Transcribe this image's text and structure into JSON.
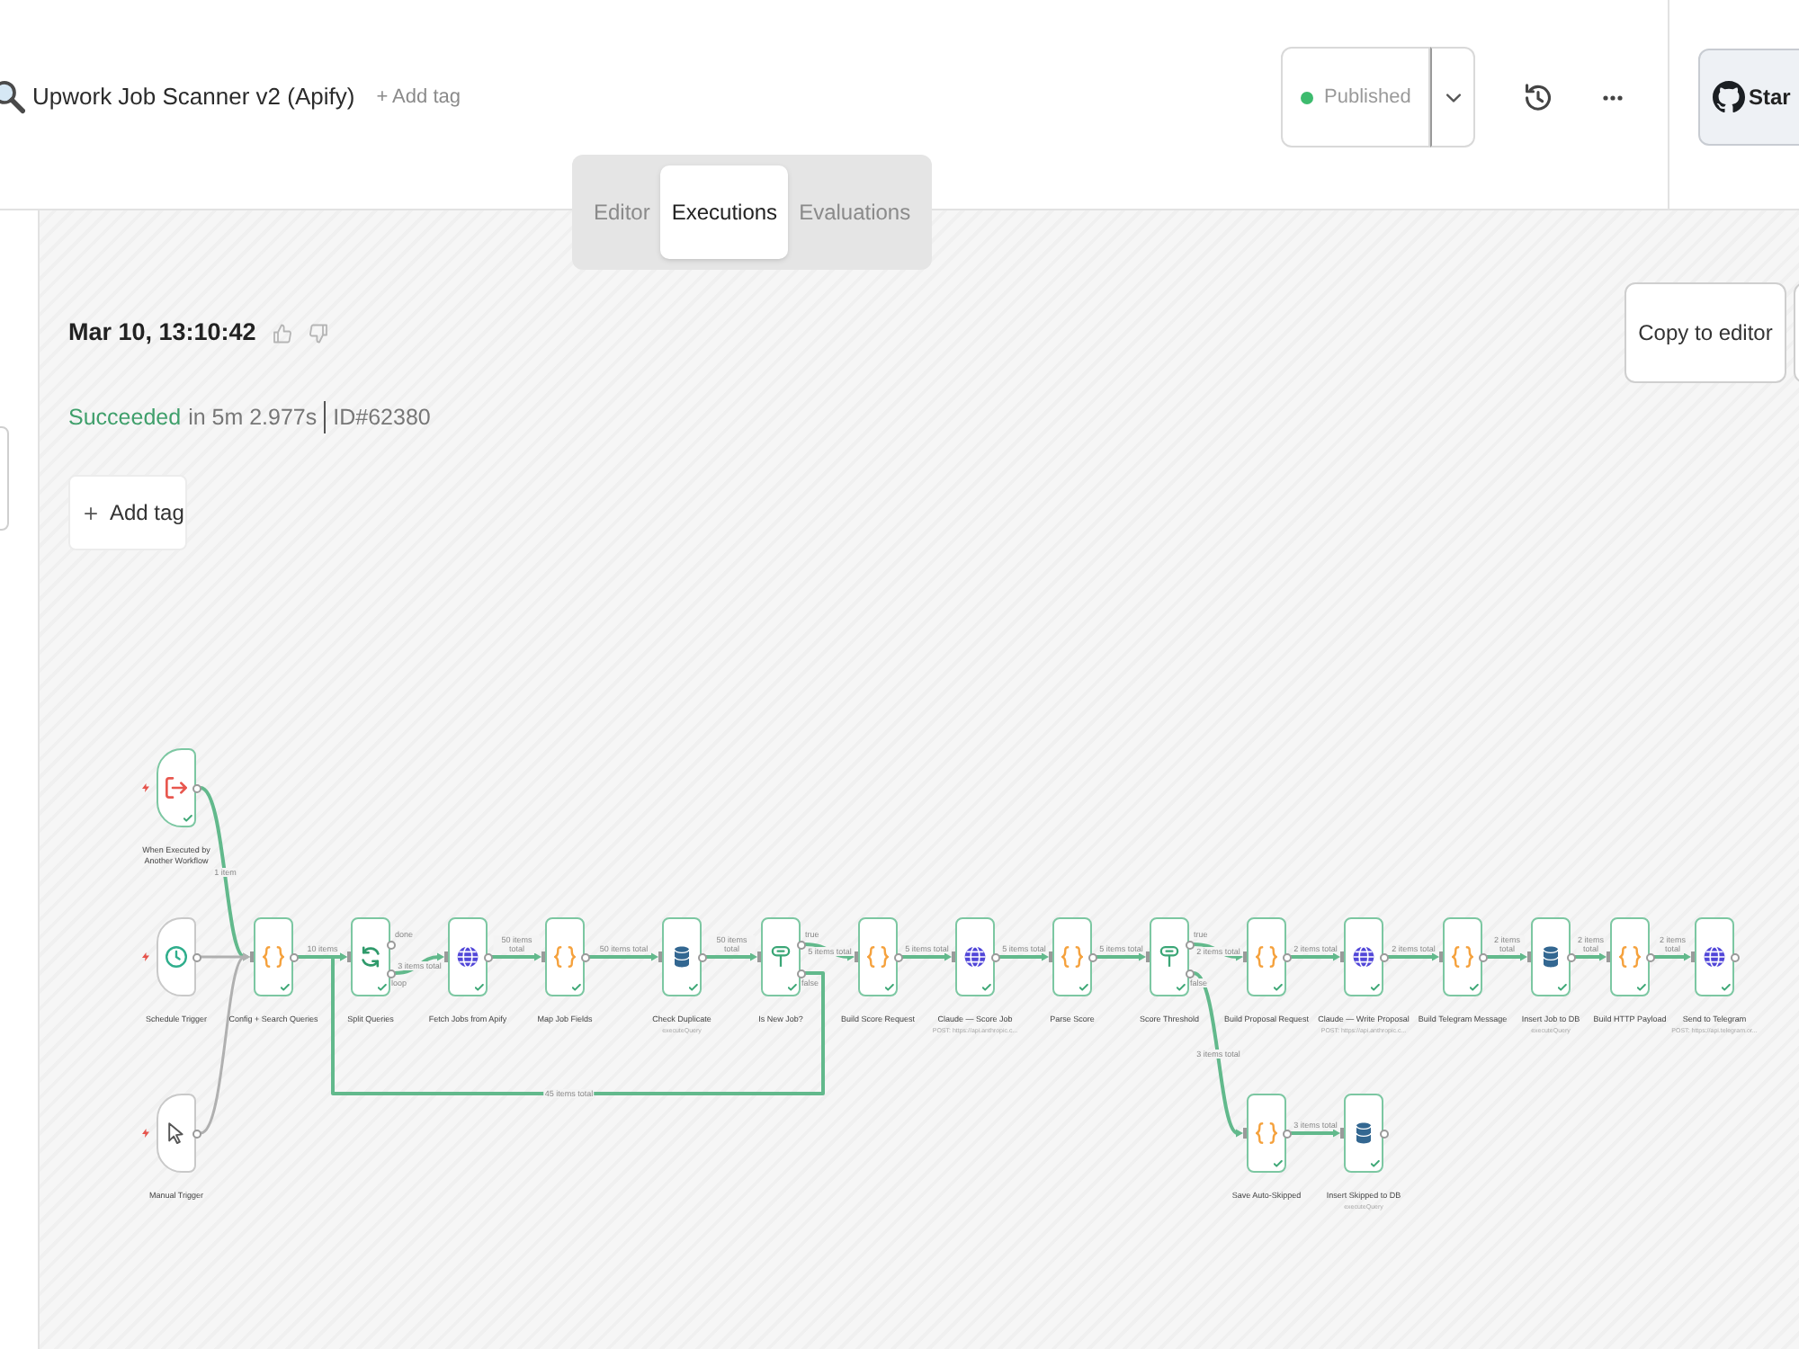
{
  "header": {
    "title": "Upwork Job Scanner v2 (Apify)",
    "add_tag": "+ Add tag",
    "publish": {
      "label": "Published",
      "published": true
    },
    "star": "Star"
  },
  "tabs": [
    {
      "label": "Editor",
      "selected": false
    },
    {
      "label": "Executions",
      "selected": true
    },
    {
      "label": "Evaluations",
      "selected": false
    }
  ],
  "execution": {
    "timestamp": "Mar 10, 13:10:42",
    "status": {
      "label": "Succeeded",
      "kind": "success"
    },
    "duration": "in 5m 2.977s",
    "id": "ID#62380",
    "add_tag": "Add tag",
    "copy_button": "Copy to editor"
  },
  "workflow": {
    "nodes": [
      {
        "kind": "workflow-trigger",
        "label": "When Executed by Another Workflow",
        "executed": true
      },
      {
        "kind": "schedule-trigger",
        "label": "Schedule Trigger",
        "executed": false
      },
      {
        "kind": "manual-trigger",
        "label": "Manual Trigger",
        "executed": false
      },
      {
        "kind": "code",
        "label": "Config + Search Queries",
        "executed": true
      },
      {
        "kind": "loop",
        "label": "Split Queries",
        "executed": true,
        "outputs": [
          "done",
          "loop"
        ]
      },
      {
        "kind": "http",
        "label": "Fetch Jobs from Apify",
        "executed": true
      },
      {
        "kind": "code",
        "label": "Map Job Fields",
        "executed": true
      },
      {
        "kind": "postgres",
        "label": "Check Duplicate",
        "subtitle": "executeQuery",
        "executed": true
      },
      {
        "kind": "if",
        "label": "Is New Job?",
        "executed": true,
        "outputs": [
          "true",
          "false"
        ]
      },
      {
        "kind": "code",
        "label": "Build Score Request",
        "executed": true
      },
      {
        "kind": "http",
        "label": "Claude — Score Job",
        "subtitle": "POST: https://api.anthropic.c...",
        "executed": true
      },
      {
        "kind": "code",
        "label": "Parse Score",
        "executed": true
      },
      {
        "kind": "if",
        "label": "Score Threshold",
        "executed": true,
        "outputs": [
          "true",
          "false"
        ]
      },
      {
        "kind": "code",
        "label": "Build Proposal Request",
        "executed": true
      },
      {
        "kind": "http",
        "label": "Claude — Write Proposal",
        "subtitle": "POST: https://api.anthropic.c...",
        "executed": true
      },
      {
        "kind": "code",
        "label": "Build Telegram Message",
        "executed": true
      },
      {
        "kind": "postgres",
        "label": "Insert Job to DB",
        "subtitle": "executeQuery",
        "executed": true
      },
      {
        "kind": "code",
        "label": "Build HTTP Payload",
        "executed": true
      },
      {
        "kind": "http",
        "label": "Send to Telegram",
        "subtitle": "POST: https://api.telegram.or...",
        "executed": true
      },
      {
        "kind": "code",
        "label": "Save Auto-Skipped",
        "executed": true
      },
      {
        "kind": "postgres",
        "label": "Insert Skipped to DB",
        "subtitle": "executeQuery",
        "executed": true
      }
    ],
    "connections": [
      {
        "label": "1 item",
        "executed": true
      },
      {
        "executed": false
      },
      {
        "executed": false
      },
      {
        "label": "10 items",
        "executed": true
      },
      {
        "label": "3 items total",
        "executed": true
      },
      {
        "label": "50 items total",
        "executed": true
      },
      {
        "label": "50 items total",
        "executed": true
      },
      {
        "label": "50 items total",
        "executed": true
      },
      {
        "label": "5 items total",
        "executed": true
      },
      {
        "label": "45 items total",
        "executed": true
      },
      {
        "label": "5 items total",
        "executed": true
      },
      {
        "label": "5 items total",
        "executed": true
      },
      {
        "label": "5 items total",
        "executed": true
      },
      {
        "label": "2 items total",
        "executed": true
      },
      {
        "label": "2 items total",
        "executed": true
      },
      {
        "label": "2 items total",
        "executed": true
      },
      {
        "label": "2 items total",
        "executed": true
      },
      {
        "label": "2 items total",
        "executed": true
      },
      {
        "label": "2 items total",
        "executed": true
      },
      {
        "label": "3 items total",
        "executed": true
      },
      {
        "label": "3 items total",
        "executed": true
      }
    ]
  }
}
